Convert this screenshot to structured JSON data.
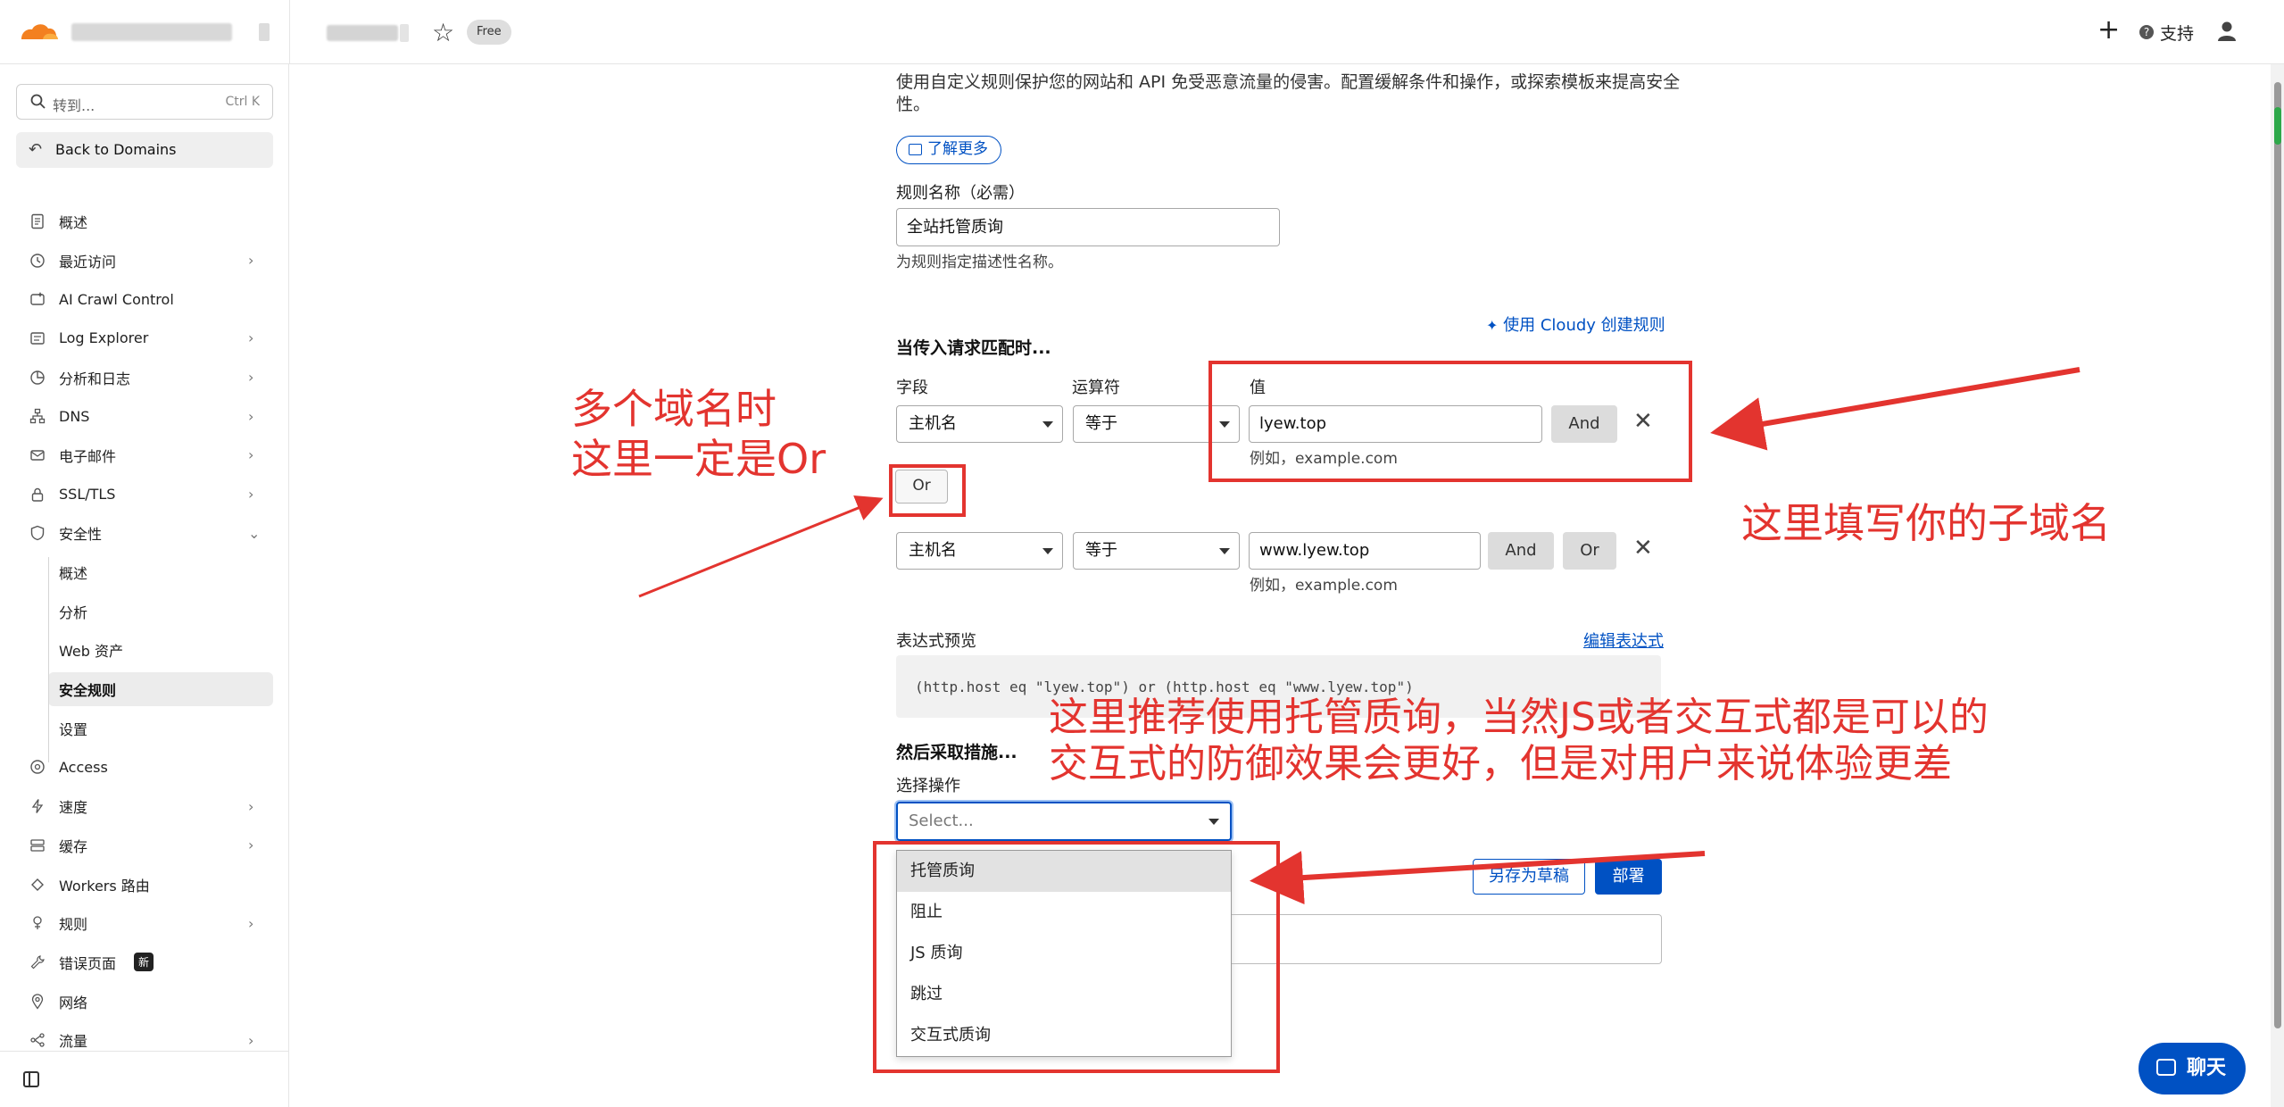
{
  "header": {
    "badge_free": "Free",
    "support_label": "支持"
  },
  "sidebar": {
    "search_placeholder": "转到...",
    "search_shortcut": "Ctrl K",
    "back_label": "Back to Domains",
    "items": [
      {
        "label": "概述",
        "icon": "document-icon",
        "chevron": false
      },
      {
        "label": "最近访问",
        "icon": "clock-icon",
        "chevron": true
      },
      {
        "label": "AI Crawl Control",
        "icon": "ai-icon",
        "chevron": false
      },
      {
        "label": "Log Explorer",
        "icon": "log-icon",
        "chevron": true
      },
      {
        "label": "分析和日志",
        "icon": "chart-icon",
        "chevron": true
      },
      {
        "label": "DNS",
        "icon": "dns-icon",
        "chevron": true
      },
      {
        "label": "电子邮件",
        "icon": "mail-icon",
        "chevron": true
      },
      {
        "label": "SSL/TLS",
        "icon": "lock-icon",
        "chevron": true
      },
      {
        "label": "安全性",
        "icon": "shield-icon",
        "chevron": true,
        "expanded": true
      },
      {
        "label": "概述",
        "sub": true
      },
      {
        "label": "分析",
        "sub": true
      },
      {
        "label": "Web 资产",
        "sub": true
      },
      {
        "label": "安全规则",
        "sub": true,
        "active": true
      },
      {
        "label": "设置",
        "sub": true
      },
      {
        "label": "Access",
        "icon": "access-icon",
        "chevron": false
      },
      {
        "label": "速度",
        "icon": "bolt-icon",
        "chevron": true
      },
      {
        "label": "缓存",
        "icon": "cache-icon",
        "chevron": true
      },
      {
        "label": "Workers 路由",
        "icon": "workers-icon",
        "chevron": false
      },
      {
        "label": "规则",
        "icon": "rules-icon",
        "chevron": true
      },
      {
        "label": "错误页面",
        "icon": "wrench-icon",
        "chevron": false,
        "badge": "新"
      },
      {
        "label": "网络",
        "icon": "pin-icon",
        "chevron": false
      },
      {
        "label": "流量",
        "icon": "traffic-icon",
        "chevron": true
      }
    ]
  },
  "main": {
    "intro": "使用自定义规则保护您的网站和 API 免受恶意流量的侵害。配置缓解条件和操作，或探索模板来提高安全性。",
    "learn_more": "了解更多",
    "rule_name_label": "规则名称（必需）",
    "rule_name_value": "全站托管质询",
    "rule_name_help": "为规则指定描述性名称。",
    "cloudy_link": "使用 Cloudy 创建规则",
    "when_heading": "当传入请求匹配时...",
    "col_field": "字段",
    "col_operator": "运算符",
    "col_value": "值",
    "row1": {
      "field": "主机名",
      "operator": "等于",
      "value": "lyew.top",
      "hint": "例如，example.com",
      "and": "And"
    },
    "or_button": "Or",
    "row2": {
      "field": "主机名",
      "operator": "等于",
      "value": "www.lyew.top",
      "hint": "例如，example.com",
      "and": "And",
      "or": "Or"
    },
    "expr_label": "表达式预览",
    "edit_expr": "编辑表达式",
    "expr_text": "(http.host eq \"lyew.top\") or (http.host eq \"www.lyew.top\")",
    "then_heading": "然后采取措施...",
    "choose_action_label": "选择操作",
    "action_placeholder": "Select...",
    "action_options": [
      "托管质询",
      "阻止",
      "JS 质询",
      "跳过",
      "交互式质询"
    ],
    "save_draft": "另存为草稿",
    "deploy": "部署"
  },
  "annotations": {
    "multi_domain": [
      "多个域名时",
      "这里一定是Or"
    ],
    "subdomain": "这里填写你的子域名",
    "recommend": [
      "这里推荐使用托管质询，当然JS或者交互式都是可以的",
      "交互式的防御效果会更好，但是对用户来说体验更差"
    ],
    "color": "#e3342f"
  },
  "chat_label": "聊天",
  "colors": {
    "accent": "#0051c3",
    "annotation": "#e3342f"
  }
}
